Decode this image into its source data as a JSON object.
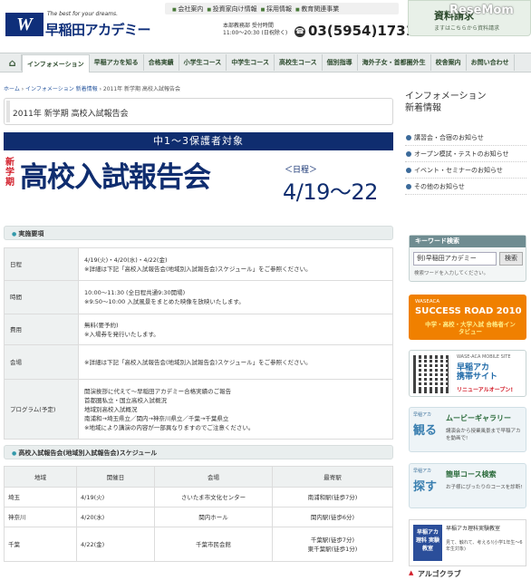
{
  "header": {
    "logo_mark": "W",
    "logo_tagline": "The best for your dreams.",
    "logo_name": "早稲田アカデミー",
    "top_links": [
      "会社案内",
      "投資家向け情報",
      "採用情報",
      "教育関連事業"
    ],
    "hq_line1": "本部教務部 受付時間",
    "hq_line2": "11:00〜20:30 (日祝除く)",
    "phone": "03(5954)1731",
    "request_title": "資料請求",
    "request_sub": "ますはこちらから資料請求",
    "watermark": "ReseMom"
  },
  "nav": [
    "インフォメーション",
    "早稲アカを知る",
    "合格実績",
    "小学生コース",
    "中学生コース",
    "高校生コース",
    "個別指導",
    "海外子女・首都圏外生",
    "校舎案内",
    "お問い合わせ"
  ],
  "breadcrumb": [
    "ホーム",
    "インフォメーション 新着情報",
    "2011年 新学期 高校入試報告会"
  ],
  "page_title": "2011年 新学期 高校入試報告会",
  "banner": {
    "top": "中1〜3保護者対象",
    "side": "新学期",
    "main": "高校入試報告会",
    "nittei": "＜日程＞",
    "date": "4/19〜22"
  },
  "outline": {
    "heading": "実施要項",
    "rows": [
      {
        "label": "日程",
        "lines": [
          "4/19(火)・4/20(水)・4/22(金)",
          "※詳細は下記「高校入試報告会(地域別入試報告会)スケジュール」をご参照ください。"
        ]
      },
      {
        "label": "時間",
        "lines": [
          "10:00〜11:30 (全日程共通9:30開場)",
          "※9:50〜10:00 入試風景をまとめた映像を放映いたします。"
        ]
      },
      {
        "label": "費用",
        "lines": [
          "無料(要予約)",
          "※入場券を発行いたします。"
        ]
      },
      {
        "label": "会場",
        "lines": [
          "※詳細は下記「高校入試報告会(地域別入試報告会)スケジュール」をご参照ください。"
        ]
      },
      {
        "label": "プログラム(予定)",
        "lines": [
          "開演挨拶に代えて〜早稲田アカデミー合格実績のご報告",
          "首都圏私立・国立高校入試概況",
          "地域別高校入試概況",
          "南浦和→埼玉県立／関内→神奈川県立／千葉→千葉県立",
          "※地域により講演の内容が一部異なりますのでご注意ください。"
        ]
      }
    ]
  },
  "schedule": {
    "heading": "高校入試報告会(地域別入試報告会)スケジュール",
    "columns": [
      "地域",
      "開催日",
      "会場",
      "最寄駅"
    ],
    "rows": [
      [
        "埼玉",
        "4/19(火)",
        "さいたま市文化センター",
        "南浦和駅(徒歩7分)"
      ],
      [
        "神奈川",
        "4/20(水)",
        "関内ホール",
        "関内駅(徒歩6分)"
      ],
      [
        "千葉",
        "4/22(金)",
        "千葉市民会館",
        "千葉駅(徒歩7分)",
        "東千葉駅(徒歩1分)"
      ]
    ]
  },
  "sidebar": {
    "heading_line1": "インフォメーション",
    "heading_line2": "新着情報",
    "news": [
      "講習会・合宿のお知らせ",
      "オープン模試・テストのお知らせ",
      "イベント・セミナーのお知らせ",
      "その他のお知らせ"
    ],
    "keyword_label": "キーワード検索",
    "keyword_value": "例)早稲田アカデミー",
    "keyword_button": "検索",
    "keyword_hint": "検索ワードを入力してください。",
    "success": {
      "a": "WASEACA",
      "b": "SUCCESS ROAD 2010",
      "c": "中学・高校・大学入試 合格者インタビュー"
    },
    "mobile": {
      "a": "WASE-ACA MOBILE SITE",
      "b1": "早稲アカ",
      "b2": "携帯サイト",
      "c": "リニューアルオープン!"
    },
    "gallery": {
      "cap": "早稲アカ",
      "big": "観る",
      "title": "ムービーギャラリー",
      "desc": "講演会から授業風景まで早稲アカを動画で!"
    },
    "course": {
      "cap": "早稲アカ",
      "big": "探す",
      "title": "簡単コース検索",
      "desc": "お子様にぴったりのコースを診断!"
    },
    "rika": {
      "logo": "早稲アカ 理科 実験教室",
      "a": "早稲アカ理科実験教室",
      "b": "見て、触れて、考える!(小学1年生〜6年生対象)"
    },
    "argo": "アルゴクラブ"
  }
}
